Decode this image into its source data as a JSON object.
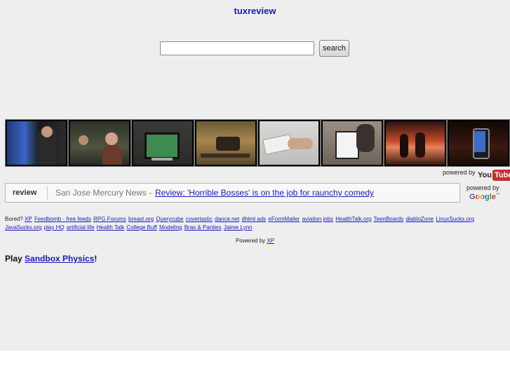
{
  "header": {
    "title": "tuxreview"
  },
  "search": {
    "placeholder": "",
    "value": "",
    "button_label": "search"
  },
  "videos": {
    "thumbnails": [
      {
        "name": "video-thumb-1"
      },
      {
        "name": "video-thumb-2"
      },
      {
        "name": "video-thumb-3"
      },
      {
        "name": "video-thumb-4"
      },
      {
        "name": "video-thumb-5"
      },
      {
        "name": "video-thumb-6"
      },
      {
        "name": "video-thumb-7"
      },
      {
        "name": "video-thumb-8"
      }
    ],
    "powered_by": "powered by",
    "logo_you": "You",
    "logo_tube": "Tube"
  },
  "news": {
    "label": "review",
    "source": "San Jose Mercury News -",
    "headline": "Review: 'Horrible Bosses' is on the job for raunchy comedy",
    "powered_by": "powered by",
    "google_logo": "Google",
    "google_tm": "™"
  },
  "links": {
    "prefix": "Bored?",
    "items": [
      "XP",
      "Feedbomb - free feeds",
      "RPG Forums",
      "breast.org",
      "Querycube",
      "covertastic",
      "dance.net",
      "dhtml ads",
      "eFormMailer",
      "aviation jobs",
      "HealthTalk.org",
      "TeenBoards",
      "diabloZone",
      "LinuxSucks.org",
      "JavaSucks.org",
      "play HQ",
      "artificial life",
      "Health Talk",
      "College Buff",
      "Modeling",
      "Bras & Panties",
      "Jaime Lynn"
    ]
  },
  "footer": {
    "powered_by_text": "Powered by",
    "powered_by_link": "XP"
  },
  "play": {
    "prefix": "Play",
    "link": "Sandbox Physics",
    "suffix": "!"
  },
  "colors": {
    "link": "#1a1ab8",
    "page_background": "#eeeeee",
    "youtube_red": "#c4302b"
  }
}
